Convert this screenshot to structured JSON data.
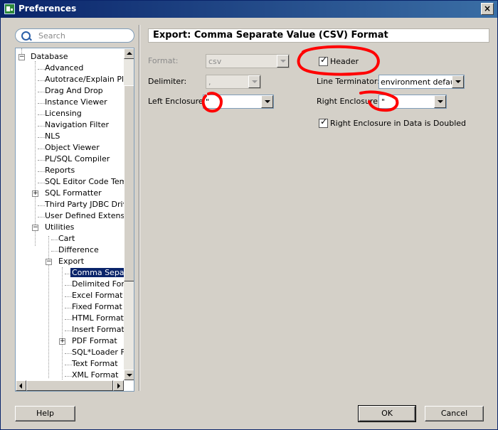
{
  "window": {
    "title": "Preferences",
    "close_glyph": "×"
  },
  "search": {
    "placeholder": "Search"
  },
  "tree": {
    "items": [
      {
        "label": "Database"
      },
      {
        "label": "Advanced"
      },
      {
        "label": "Autotrace/Explain Plan"
      },
      {
        "label": "Drag And Drop"
      },
      {
        "label": "Instance Viewer"
      },
      {
        "label": "Licensing"
      },
      {
        "label": "Navigation Filter"
      },
      {
        "label": "NLS"
      },
      {
        "label": "Object Viewer"
      },
      {
        "label": "PL/SQL Compiler"
      },
      {
        "label": "Reports"
      },
      {
        "label": "SQL Editor Code Templates"
      },
      {
        "label": "SQL Formatter"
      },
      {
        "label": "Third Party JDBC Drivers"
      },
      {
        "label": "User Defined Extensions"
      },
      {
        "label": "Utilities"
      },
      {
        "label": "Cart"
      },
      {
        "label": "Difference"
      },
      {
        "label": "Export"
      },
      {
        "label": "Comma Separated"
      },
      {
        "label": "Delimited Format"
      },
      {
        "label": "Excel Format"
      },
      {
        "label": "Fixed Format"
      },
      {
        "label": "HTML Format"
      },
      {
        "label": "Insert Format"
      },
      {
        "label": "PDF Format"
      },
      {
        "label": "SQL*Loader Format"
      },
      {
        "label": "Text Format"
      },
      {
        "label": "XML Format"
      }
    ],
    "collapse_glyph": "−",
    "expand_glyph": "+"
  },
  "panel": {
    "title": "Export: Comma Separate Value (CSV) Format",
    "format_label": "Format:",
    "format_value": "csv",
    "header_label": "Header",
    "header_checked": true,
    "delimiter_label": "Delimiter:",
    "delimiter_value": ",",
    "line_terminator_label": "Line Terminator:",
    "line_terminator_value": "environment default",
    "left_enclosure_label": "Left Enclosure:",
    "left_enclosure_value": "\"",
    "right_enclosure_label": "Right Enclosure:",
    "right_enclosure_value": "\"",
    "doubled_label": "Right Enclosure in Data is Doubled",
    "doubled_checked": true,
    "check_glyph": "✓"
  },
  "buttons": {
    "help": "Help",
    "ok": "OK",
    "cancel": "Cancel"
  },
  "colors": {
    "annotation": "#ff0000",
    "selection": "#0a246a",
    "titlebar": "#0a246a"
  }
}
